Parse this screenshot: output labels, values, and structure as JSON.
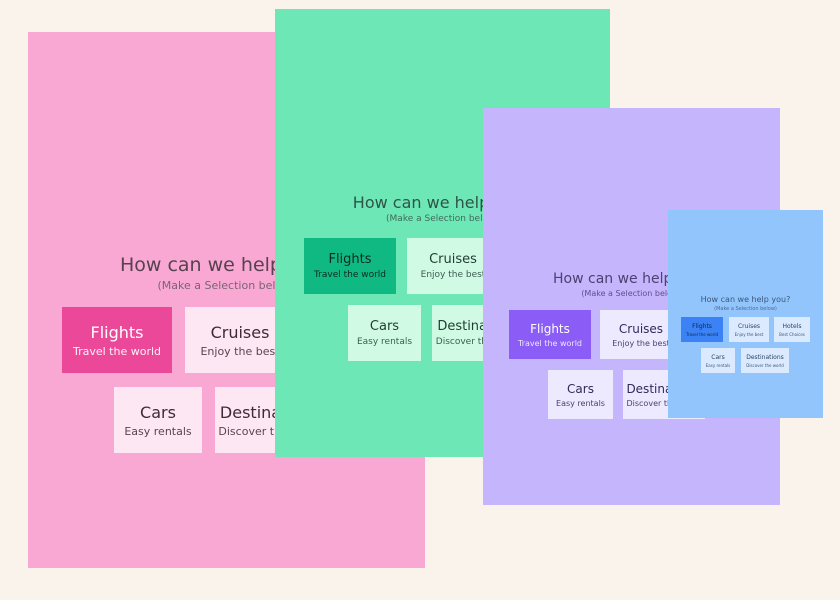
{
  "colors": {
    "background": "#f9f3ec",
    "pink_panel": "#f9a8d4",
    "pink_selected": "#ec4899",
    "green_panel": "#6ee7b7",
    "green_selected": "#10b981",
    "purple_panel": "#c4b5fd",
    "purple_selected": "#8b5cf6",
    "blue_panel": "#93c5fd",
    "blue_selected": "#3b82f6"
  },
  "panels": [
    {
      "title": "How can we help you?",
      "subtitle": "(Make a Selection below)",
      "tiles": [
        {
          "title": "Flights",
          "subtitle": "Travel the world",
          "selected": true
        },
        {
          "title": "Cruises",
          "subtitle": "Enjoy the best"
        },
        {
          "title": "Cars",
          "subtitle": "Easy rentals"
        },
        {
          "title": "Destinations",
          "subtitle": "Discover the world"
        }
      ]
    },
    {
      "title": "How can we help you?",
      "subtitle": "(Make a Selection below)",
      "tiles": [
        {
          "title": "Flights",
          "subtitle": "Travel the world",
          "selected": true
        },
        {
          "title": "Cruises",
          "subtitle": "Enjoy the best"
        },
        {
          "title": "Cars",
          "subtitle": "Easy rentals"
        },
        {
          "title": "Destinations",
          "subtitle": "Discover the world"
        }
      ]
    },
    {
      "title": "How can we help you?",
      "subtitle": "(Make a Selection below)",
      "tiles": [
        {
          "title": "Flights",
          "subtitle": "Travel the world",
          "selected": true
        },
        {
          "title": "Cruises",
          "subtitle": "Enjoy the best"
        },
        {
          "title": "Cars",
          "subtitle": "Easy rentals"
        },
        {
          "title": "Destinations",
          "subtitle": "Discover the world"
        }
      ]
    },
    {
      "title": "How can we help you?",
      "subtitle": "(Make a Selection below)",
      "tiles": [
        {
          "title": "Flights",
          "subtitle": "Travel the world",
          "selected": true
        },
        {
          "title": "Cruises",
          "subtitle": "Enjoy the best"
        },
        {
          "title": "Hotels",
          "subtitle": "Best Choices"
        },
        {
          "title": "Cars",
          "subtitle": "Easy rentals"
        },
        {
          "title": "Destinations",
          "subtitle": "Discover the world"
        }
      ]
    }
  ]
}
